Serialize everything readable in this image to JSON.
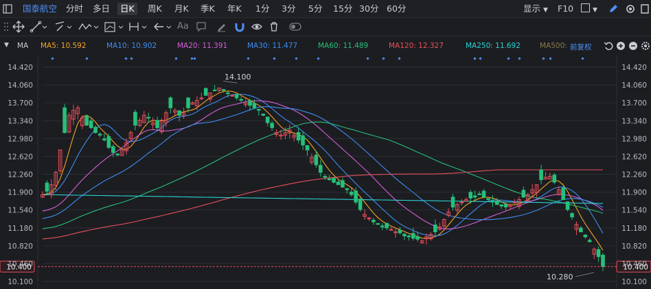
{
  "topbar": {
    "stock_name": "国泰航空",
    "periods": [
      "分时",
      "多日",
      "日K",
      "周K",
      "月K",
      "季K",
      "年K",
      "1分",
      "3分",
      "5分",
      "15分",
      "30分",
      "60分"
    ],
    "active_period": "日K",
    "display_label": "显示",
    "f10_label": "F10"
  },
  "toolbar": {
    "text_tool_label": "Aa"
  },
  "ma_bar": {
    "indicator_label": "MA",
    "adjust_label": "前复权",
    "items": [
      {
        "label": "MA5: 10.592",
        "color": "#f5a623"
      },
      {
        "label": "MA10: 10.902",
        "color": "#3d8ef0"
      },
      {
        "label": "MA20: 11.391",
        "color": "#d45fd6"
      },
      {
        "label": "MA30: 11.477",
        "color": "#3d8ef0"
      },
      {
        "label": "MA60: 11.489",
        "color": "#26c07a"
      },
      {
        "label": "MA120: 12.327",
        "color": "#e8505b"
      },
      {
        "label": "MA250: 11.692",
        "color": "#2ad4d4"
      },
      {
        "label": "MA500:",
        "color": "#8a7a4a"
      }
    ]
  },
  "chart_data": {
    "type": "candlestick",
    "y_ticks": [
      "14.420",
      "14.060",
      "13.700",
      "13.340",
      "12.980",
      "12.620",
      "12.260",
      "11.900",
      "11.540",
      "11.180",
      "10.820",
      "10.460",
      "10.100"
    ],
    "ylim": [
      10.1,
      14.42
    ],
    "last_price_label": "10.400",
    "last_price": 10.4,
    "high_annotation": "14.100",
    "high_value": 14.1,
    "low_annotation": "10.280",
    "low_value": 10.28,
    "colors": {
      "up": "#e8505b",
      "down": "#26c07a",
      "grid": "#2b2e35",
      "axis_text": "#b7bac2",
      "last": "#e8505b"
    },
    "ma_series": [
      {
        "name": "MA5",
        "color": "#f5a623"
      },
      {
        "name": "MA10",
        "color": "#3d8ef0"
      },
      {
        "name": "MA20",
        "color": "#d45fd6"
      },
      {
        "name": "MA30",
        "color": "#3d8ef0"
      },
      {
        "name": "MA60",
        "color": "#26c07a"
      },
      {
        "name": "MA120",
        "color": "#e8505b"
      },
      {
        "name": "MA250",
        "color": "#2ad4d4"
      }
    ],
    "closes": [
      11.85,
      11.92,
      12.05,
      12.3,
      12.75,
      13.1,
      13.45,
      13.55,
      13.6,
      13.4,
      13.25,
      13.2,
      13.1,
      13.05,
      12.95,
      12.8,
      12.7,
      12.65,
      12.75,
      12.9,
      13.1,
      13.25,
      13.35,
      13.45,
      13.4,
      13.3,
      13.2,
      13.35,
      13.5,
      13.6,
      13.55,
      13.45,
      13.5,
      13.6,
      13.7,
      13.75,
      13.8,
      13.85,
      13.9,
      13.95,
      14.0,
      13.95,
      13.9,
      13.85,
      13.8,
      13.75,
      13.7,
      13.65,
      13.6,
      13.55,
      13.45,
      13.3,
      13.2,
      13.1,
      13.05,
      13.1,
      13.15,
      13.05,
      12.95,
      12.85,
      12.75,
      12.6,
      12.45,
      12.3,
      12.2,
      12.15,
      12.1,
      12.05,
      12.0,
      11.95,
      11.85,
      11.7,
      11.55,
      11.45,
      11.38,
      11.3,
      11.25,
      11.2,
      11.18,
      11.15,
      11.1,
      11.08,
      11.02,
      11.0,
      10.97,
      10.95,
      10.92,
      11.0,
      11.05,
      11.1,
      11.2,
      11.35,
      11.5,
      11.6,
      11.65,
      11.7,
      11.75,
      11.78,
      11.8,
      11.85,
      11.8,
      11.75,
      11.7,
      11.65,
      11.62,
      11.6,
      11.65,
      11.7,
      11.75,
      11.8,
      11.85,
      11.95,
      12.05,
      12.15,
      12.2,
      12.22,
      12.1,
      11.95,
      11.75,
      11.55,
      11.4,
      11.25,
      11.1,
      11.0,
      10.9,
      10.75,
      10.6,
      10.4
    ]
  }
}
